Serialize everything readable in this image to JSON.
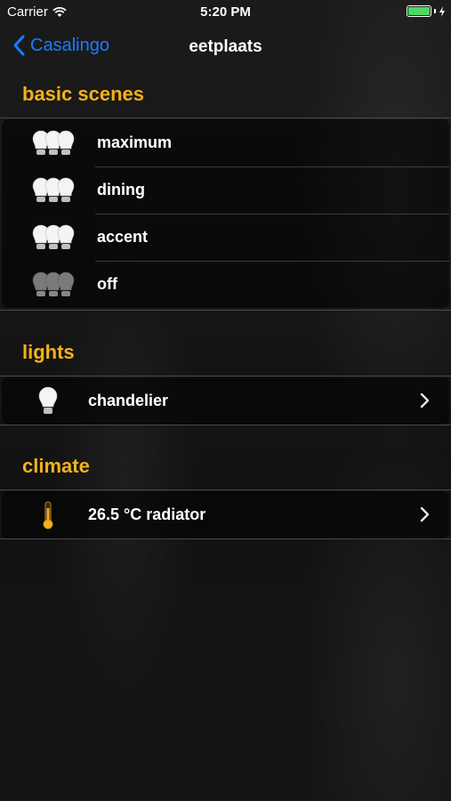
{
  "status": {
    "carrier": "Carrier",
    "time": "5:20 PM",
    "battery_level": 1.0,
    "battery_color": "#4cd964"
  },
  "nav": {
    "back_label": "Casalingo",
    "title": "eetplaats"
  },
  "sections": {
    "basic_scenes": {
      "title": "basic scenes",
      "items": [
        {
          "label": "maximum",
          "icon": "three-bulbs-on-icon"
        },
        {
          "label": "dining",
          "icon": "three-bulbs-on-icon"
        },
        {
          "label": "accent",
          "icon": "three-bulbs-on-icon"
        },
        {
          "label": "off",
          "icon": "three-bulbs-off-icon"
        }
      ]
    },
    "lights": {
      "title": "lights",
      "items": [
        {
          "label": "chandelier",
          "icon": "bulb-on-icon"
        }
      ]
    },
    "climate": {
      "title": "climate",
      "items": [
        {
          "label": "26.5 °C  radiator",
          "icon": "thermometer-icon"
        }
      ]
    }
  },
  "colors": {
    "accent": "#f2b21b",
    "link": "#1a7cff"
  }
}
